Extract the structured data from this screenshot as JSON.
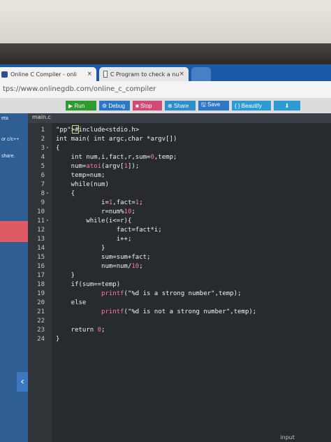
{
  "browser": {
    "tabs": [
      {
        "title": "Online C Compiler - onli",
        "close": "×"
      },
      {
        "title": "C Program to check a nu",
        "close": "×"
      }
    ],
    "url": "tps://www.onlinegdb.com/online_c_compiler"
  },
  "toolbar": {
    "run": "▶ Run",
    "debug": "⚙ Debug",
    "stop": "■ Stop",
    "share": "⊕ Share",
    "save": "🖫 Save",
    "beautify": "{ } Beautify",
    "download": "⬇"
  },
  "sidebar": {
    "items": [
      "eta",
      "or c/c++",
      "share."
    ]
  },
  "editor": {
    "filename": "main.c",
    "lines": [
      {
        "n": "1",
        "fold": "",
        "text": "#include<stdio.h>"
      },
      {
        "n": "2",
        "fold": "",
        "text": "int main( int argc,char *argv[])"
      },
      {
        "n": "3",
        "fold": "▾",
        "text": "{"
      },
      {
        "n": "4",
        "fold": "",
        "text": "    int num,i,fact,r,sum=0,temp;"
      },
      {
        "n": "5",
        "fold": "",
        "text": "    num=atoi(argv[1]);"
      },
      {
        "n": "6",
        "fold": "",
        "text": "    temp=num;"
      },
      {
        "n": "7",
        "fold": "",
        "text": "    while(num)"
      },
      {
        "n": "8",
        "fold": "▾",
        "text": "    {"
      },
      {
        "n": "9",
        "fold": "",
        "text": "            i=1,fact=1;"
      },
      {
        "n": "10",
        "fold": "",
        "text": "            r=num%10;"
      },
      {
        "n": "11",
        "fold": "▾",
        "text": "        while(i<=r){"
      },
      {
        "n": "12",
        "fold": "",
        "text": "                fact=fact*i;"
      },
      {
        "n": "13",
        "fold": "",
        "text": "                i++;"
      },
      {
        "n": "14",
        "fold": "",
        "text": "            }"
      },
      {
        "n": "15",
        "fold": "",
        "text": "            sum=sum+fact;"
      },
      {
        "n": "16",
        "fold": "",
        "text": "            num=num/10;"
      },
      {
        "n": "17",
        "fold": "",
        "text": "    }"
      },
      {
        "n": "18",
        "fold": "",
        "text": "    if(sum==temp)"
      },
      {
        "n": "19",
        "fold": "",
        "text": "            printf(\"%d is a strong number\",temp);"
      },
      {
        "n": "20",
        "fold": "",
        "text": "    else"
      },
      {
        "n": "21",
        "fold": "",
        "text": "            printf(\"%d is not a strong number\",temp);"
      },
      {
        "n": "22",
        "fold": "",
        "text": ""
      },
      {
        "n": "23",
        "fold": "",
        "text": "    return 0;"
      },
      {
        "n": "24",
        "fold": "",
        "text": "}"
      }
    ],
    "input_label": "input"
  },
  "colors": {
    "run": "#2f9a2f",
    "stop": "#d24a76",
    "tabbar": "#1b5aa6",
    "sidebar": "#2f5f92"
  }
}
